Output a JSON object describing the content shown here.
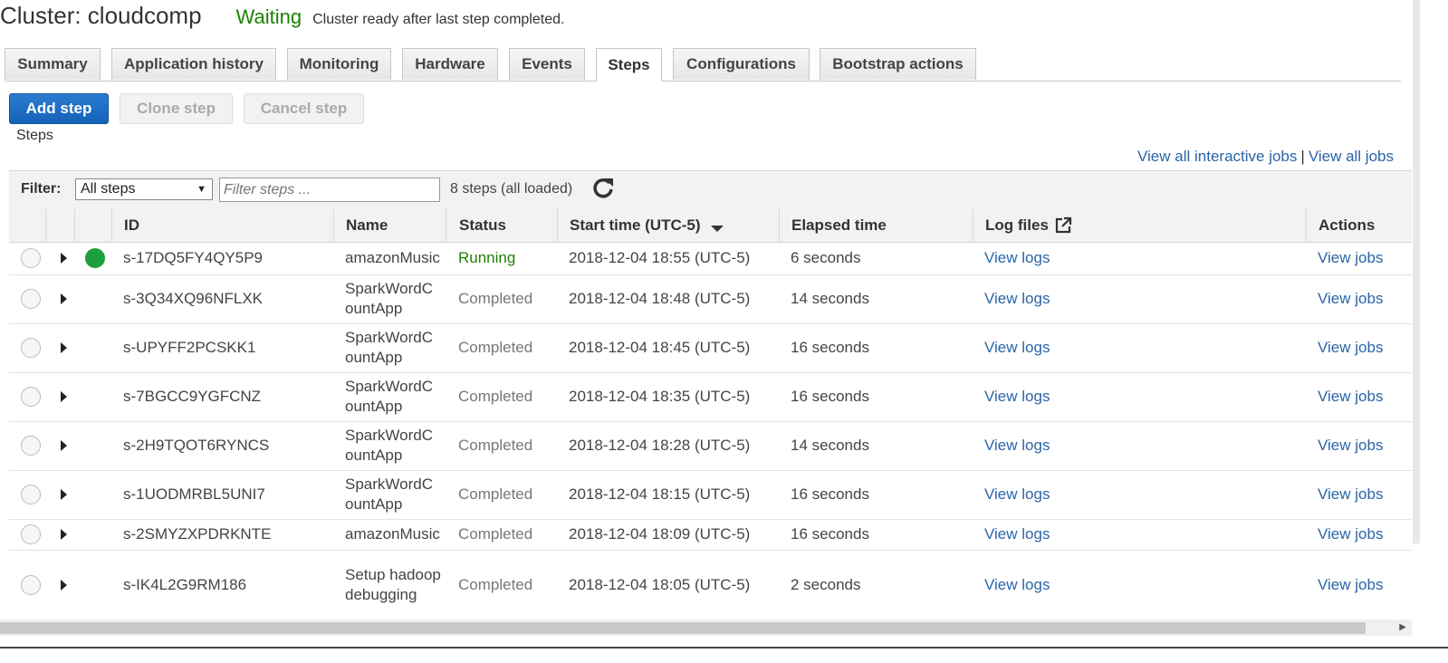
{
  "header": {
    "title": "Cluster: cloudcomp",
    "state": "Waiting",
    "state_message": "Cluster ready after last step completed."
  },
  "tabs": [
    {
      "label": "Summary",
      "active": false
    },
    {
      "label": "Application history",
      "active": false
    },
    {
      "label": "Monitoring",
      "active": false
    },
    {
      "label": "Hardware",
      "active": false
    },
    {
      "label": "Events",
      "active": false
    },
    {
      "label": "Steps",
      "active": true
    },
    {
      "label": "Configurations",
      "active": false
    },
    {
      "label": "Bootstrap actions",
      "active": false
    }
  ],
  "toolbar": {
    "add_step": "Add step",
    "clone_step": "Clone step",
    "cancel_step": "Cancel step"
  },
  "steps_label": "Steps",
  "links": {
    "interactive_jobs": "View all interactive jobs",
    "separator": "|",
    "all_jobs": "View all jobs"
  },
  "filter": {
    "label": "Filter:",
    "selected": "All steps",
    "placeholder": "Filter steps ...",
    "count": "8 steps (all loaded)"
  },
  "columns": {
    "id": "ID",
    "name": "Name",
    "status": "Status",
    "start_time": "Start time (UTC-5)",
    "elapsed": "Elapsed time",
    "log_files": "Log files",
    "actions": "Actions"
  },
  "rows": [
    {
      "id": "s-17DQ5FY4QY5P9",
      "name": "amazonMusic",
      "status": "Running",
      "start": "2018-12-04 18:55 (UTC-5)",
      "elapsed": "6 seconds",
      "logs": "View logs",
      "action": "View jobs"
    },
    {
      "id": "s-3Q34XQ96NFLXK",
      "name": "SparkWordC ountApp",
      "status": "Completed",
      "start": "2018-12-04 18:48 (UTC-5)",
      "elapsed": "14 seconds",
      "logs": "View logs",
      "action": "View jobs"
    },
    {
      "id": "s-UPYFF2PCSKK1",
      "name": "SparkWordC ountApp",
      "status": "Completed",
      "start": "2018-12-04 18:45 (UTC-5)",
      "elapsed": "16 seconds",
      "logs": "View logs",
      "action": "View jobs"
    },
    {
      "id": "s-7BGCC9YGFCNZ",
      "name": "SparkWordC ountApp",
      "status": "Completed",
      "start": "2018-12-04 18:35 (UTC-5)",
      "elapsed": "16 seconds",
      "logs": "View logs",
      "action": "View jobs"
    },
    {
      "id": "s-2H9TQOT6RYNCS",
      "name": "SparkWordC ountApp",
      "status": "Completed",
      "start": "2018-12-04 18:28 (UTC-5)",
      "elapsed": "14 seconds",
      "logs": "View logs",
      "action": "View jobs"
    },
    {
      "id": "s-1UODMRBL5UNI7",
      "name": "SparkWordC ountApp",
      "status": "Completed",
      "start": "2018-12-04 18:15 (UTC-5)",
      "elapsed": "16 seconds",
      "logs": "View logs",
      "action": "View jobs"
    },
    {
      "id": "s-2SMYZXPDRKNTE",
      "name": "amazonMusic",
      "status": "Completed",
      "start": "2018-12-04 18:09 (UTC-5)",
      "elapsed": "16 seconds",
      "logs": "View logs",
      "action": "View jobs"
    },
    {
      "id": "s-IK4L2G9RM186",
      "name": "Setup hadoop debugging",
      "status": "Completed",
      "start": "2018-12-04 18:05 (UTC-5)",
      "elapsed": "2 seconds",
      "logs": "View logs",
      "action": "View jobs"
    }
  ],
  "colors": {
    "primary": "#1463b8",
    "running": "#1d8102",
    "link": "#2a65a8"
  }
}
